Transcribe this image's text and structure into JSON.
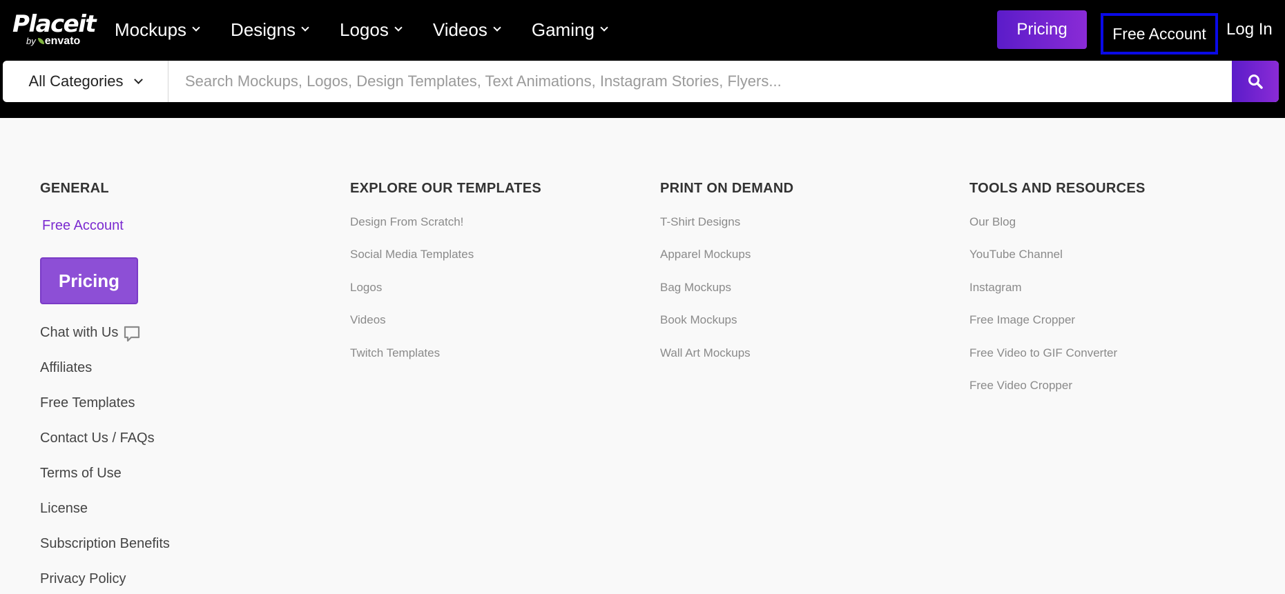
{
  "logo": {
    "main": "Placeit",
    "by": "by",
    "brand": "envato"
  },
  "nav": [
    {
      "label": "Mockups"
    },
    {
      "label": "Designs"
    },
    {
      "label": "Logos"
    },
    {
      "label": "Videos"
    },
    {
      "label": "Gaming"
    }
  ],
  "header": {
    "pricing": "Pricing",
    "free_account": "Free Account",
    "login": "Log In"
  },
  "search": {
    "category": "All Categories",
    "placeholder": "Search Mockups, Logos, Design Templates, Text Animations, Instagram Stories, Flyers..."
  },
  "footer": {
    "general": {
      "heading": "GENERAL",
      "free_account": "Free Account",
      "pricing": "Pricing",
      "chat": "Chat with Us",
      "links": [
        "Affiliates",
        "Free Templates",
        "Contact Us / FAQs",
        "Terms of Use",
        "License",
        "Subscription Benefits",
        "Privacy Policy"
      ]
    },
    "explore": {
      "heading": "EXPLORE OUR TEMPLATES",
      "links": [
        "Design From Scratch!",
        "Social Media Templates",
        "Logos",
        "Videos",
        "Twitch Templates"
      ]
    },
    "print": {
      "heading": "PRINT ON DEMAND",
      "links": [
        "T-Shirt Designs",
        "Apparel Mockups",
        "Bag Mockups",
        "Book Mockups",
        "Wall Art Mockups"
      ]
    },
    "tools": {
      "heading": "TOOLS AND RESOURCES",
      "links": [
        "Our Blog",
        "YouTube Channel",
        "Instagram",
        "Free Image Cropper",
        "Free Video to GIF Converter",
        "Free Video Cropper"
      ]
    }
  },
  "colors": {
    "accent": "#7b2bd0",
    "highlight_box": "#0a0ae6",
    "header_bg": "#000000"
  }
}
